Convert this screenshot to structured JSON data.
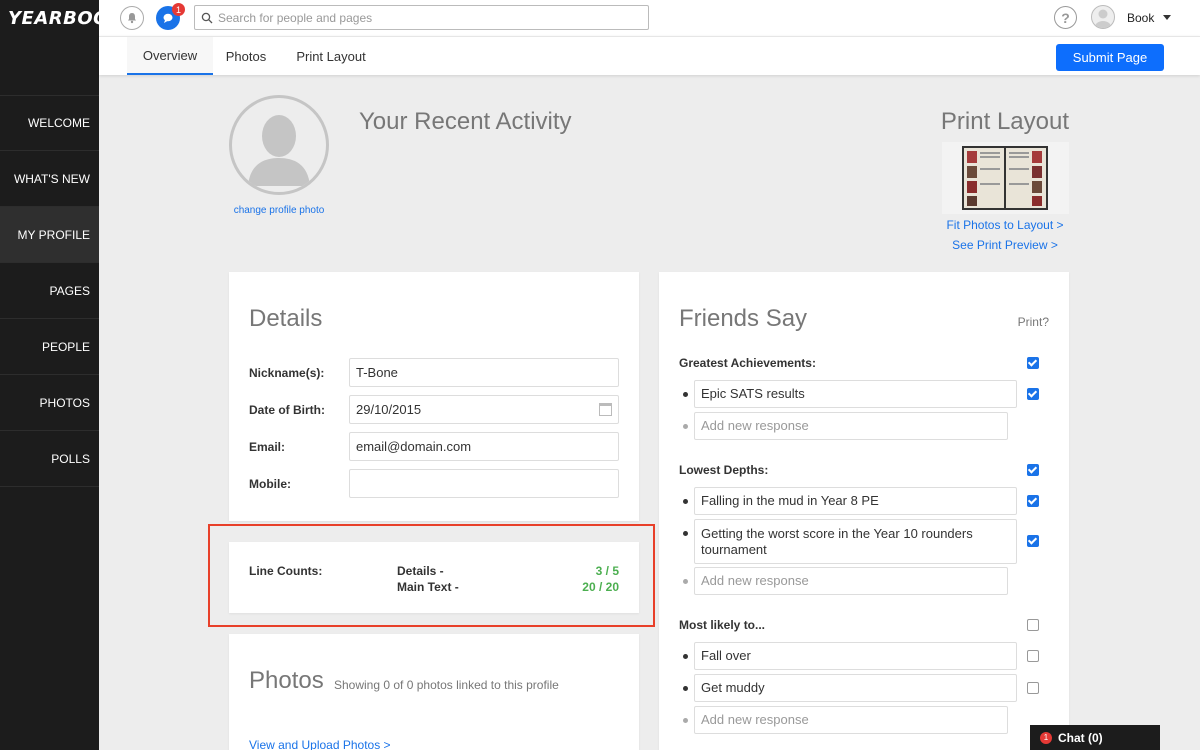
{
  "app": {
    "logo": "YEARBOOK"
  },
  "sidebar": {
    "items": [
      {
        "label": "WELCOME"
      },
      {
        "label": "WHAT'S NEW"
      },
      {
        "label": "MY PROFILE",
        "active": true
      },
      {
        "label": "PAGES"
      },
      {
        "label": "PEOPLE"
      },
      {
        "label": "PHOTOS"
      },
      {
        "label": "POLLS"
      }
    ]
  },
  "topbar": {
    "notification_badge": "1",
    "search_placeholder": "Search for people and pages",
    "help_glyph": "?",
    "username": "Book"
  },
  "subnav": {
    "tabs": [
      {
        "label": "Overview",
        "active": true
      },
      {
        "label": "Photos"
      },
      {
        "label": "Print Layout"
      }
    ],
    "submit_label": "Submit Page"
  },
  "profile": {
    "change_photo": "change profile photo",
    "recent_title": "Your Recent Activity"
  },
  "print_layout": {
    "title": "Print Layout",
    "link_fit": "Fit Photos to Layout >",
    "link_preview": "See Print Preview >"
  },
  "details": {
    "title": "Details",
    "fields": [
      {
        "label": "Nickname(s):",
        "value": "T-Bone"
      },
      {
        "label": "Date of Birth:",
        "value": "29/10/2015"
      },
      {
        "label": "Email:",
        "value": "email@domain.com"
      },
      {
        "label": "Mobile:",
        "value": ""
      }
    ]
  },
  "line_counts": {
    "label": "Line Counts:",
    "details_label": "Details -",
    "details_value": "3 / 5",
    "main_label": "Main Text -",
    "main_value": "20 / 20"
  },
  "photos": {
    "title": "Photos",
    "subtitle": "Showing 0 of 0 photos linked to this profile",
    "link": "View and Upload Photos >"
  },
  "friends": {
    "title": "Friends Say",
    "print_label": "Print?",
    "new_placeholder": "Add new response",
    "sections": [
      {
        "label": "Greatest Achievements:",
        "checked": true,
        "responses": [
          {
            "text": "Epic SATS results",
            "checked": true
          }
        ]
      },
      {
        "label": "Lowest Depths:",
        "checked": true,
        "responses": [
          {
            "text": "Falling in the mud in Year 8 PE",
            "checked": true
          },
          {
            "text": "Getting the worst score in the Year 10 rounders tournament",
            "checked": true
          }
        ]
      },
      {
        "label": "Most likely to...",
        "checked": false,
        "responses": [
          {
            "text": "Fall over",
            "checked": false
          },
          {
            "text": "Get muddy",
            "checked": false
          }
        ]
      }
    ]
  },
  "chat": {
    "badge": "1",
    "label": "Chat (0)"
  },
  "colors": {
    "accent": "#1a73e8",
    "sidebar": "#1c1c1c",
    "success": "#4caf50",
    "highlight": "#e8402a",
    "badge": "#e53935"
  }
}
